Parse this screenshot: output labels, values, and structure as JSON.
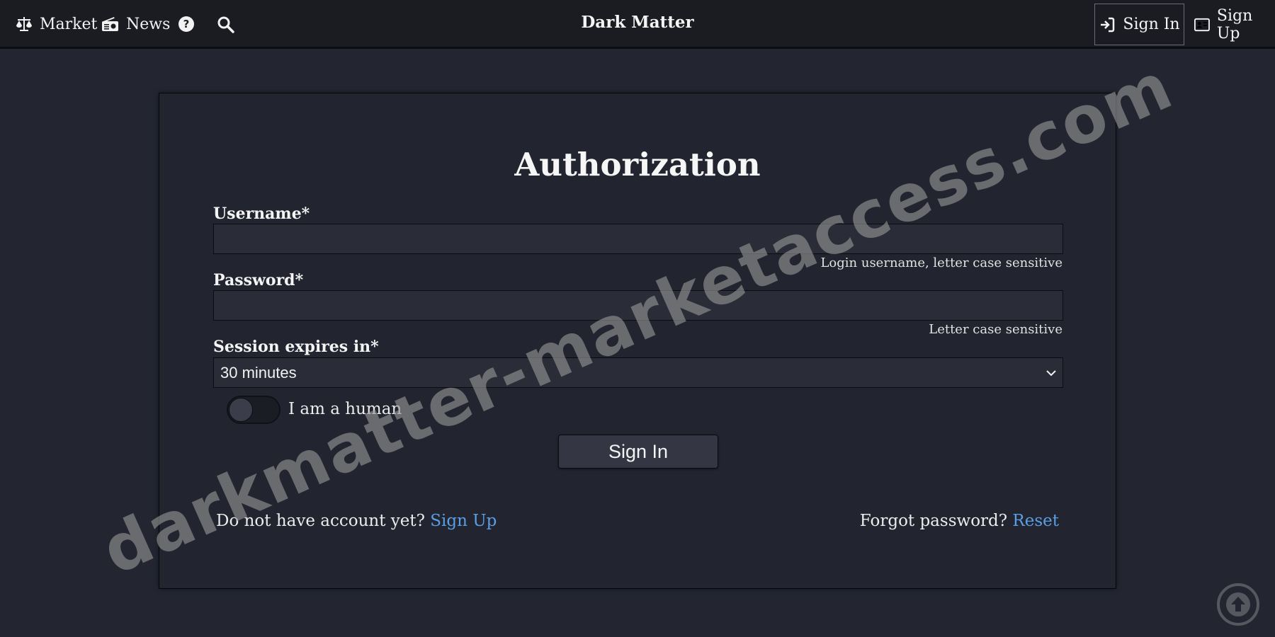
{
  "nav": {
    "market_label": "Market",
    "news_label": "News",
    "brand": "Dark Matter",
    "signin_label": "Sign In",
    "signup_label": "Sign Up",
    "icons": [
      "balance-scale-icon",
      "radio-icon",
      "question-circle-icon",
      "search-icon",
      "sign-in-icon",
      "id-card-icon"
    ]
  },
  "form": {
    "title": "Authorization",
    "username_label": "Username*",
    "username_value": "",
    "username_hint": "Login username, letter case sensitive",
    "password_label": "Password*",
    "password_value": "",
    "password_hint": "Letter case sensitive",
    "session_label": "Session expires in*",
    "session_selected": "30 minutes",
    "human_label": "I am a human",
    "human_checked": false,
    "submit_label": "Sign In"
  },
  "footer": {
    "no_account_text": "Do not have account yet?",
    "signup_link": "Sign Up",
    "forgot_text": "Forgot password?",
    "reset_link": "Reset"
  },
  "watermark": "darkmatter-marketaccess.com",
  "colors": {
    "background": "#232631",
    "topbar": "#1a1c22",
    "link": "#5a9fe6"
  }
}
